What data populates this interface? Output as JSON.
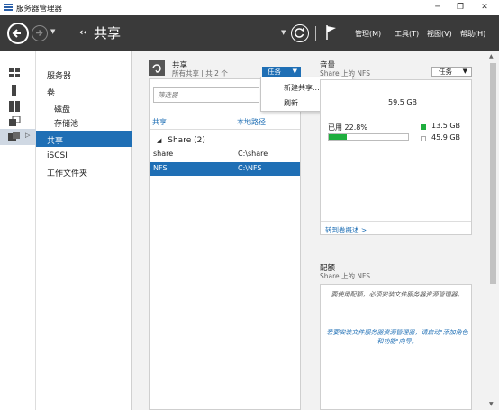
{
  "window": {
    "title": "服务器管理器",
    "minimize": "─",
    "maximize": "❐",
    "close": "✕"
  },
  "header": {
    "breadcrumb_arrows": "‹‹",
    "breadcrumb_title": "共享",
    "menu": [
      "管理(M)",
      "工具(T)",
      "视图(V)",
      "帮助(H)"
    ]
  },
  "nav": {
    "items": [
      {
        "label": "服务器"
      },
      {
        "label": "卷"
      },
      {
        "label": "磁盘"
      },
      {
        "label": "存储池"
      },
      {
        "label": "共享"
      },
      {
        "label": "iSCSI"
      },
      {
        "label": "工作文件夹"
      }
    ],
    "selected_index": 4
  },
  "shares": {
    "title": "共享",
    "subtitle": "所有共享 | 共 2 个",
    "tasks_label": "任务",
    "filter_placeholder": "筛选器",
    "columns": [
      "共享",
      "本地路径"
    ],
    "group": "Share (2)",
    "rows": [
      {
        "name": "share",
        "path": "C:\\share",
        "selected": false
      },
      {
        "name": "NFS",
        "path": "C:\\NFS",
        "selected": true
      }
    ]
  },
  "tasks_menu": {
    "items": [
      "新建共享...",
      "刷新"
    ]
  },
  "volume": {
    "title": "音量",
    "subtitle": "Share 上的 NFS",
    "tasks_label": "任务",
    "capacity": "59.5 GB",
    "used_label": "已用 22.8%",
    "used_fraction": 0.228,
    "used_size": "13.5 GB",
    "free_size": "45.9 GB",
    "used_color": "#1fae3e",
    "link": "转到卷概述 >"
  },
  "quota": {
    "title": "配额",
    "subtitle": "Share 上的 NFS",
    "msg1": "要使用配额，必须安装文件服务器资源管理器。",
    "msg2": "若要安装文件服务器资源管理器，请启动\"添加角色和功能\"向导。"
  },
  "colors": {
    "accent": "#1f6fb5",
    "header_bg": "#3a3a3a"
  }
}
